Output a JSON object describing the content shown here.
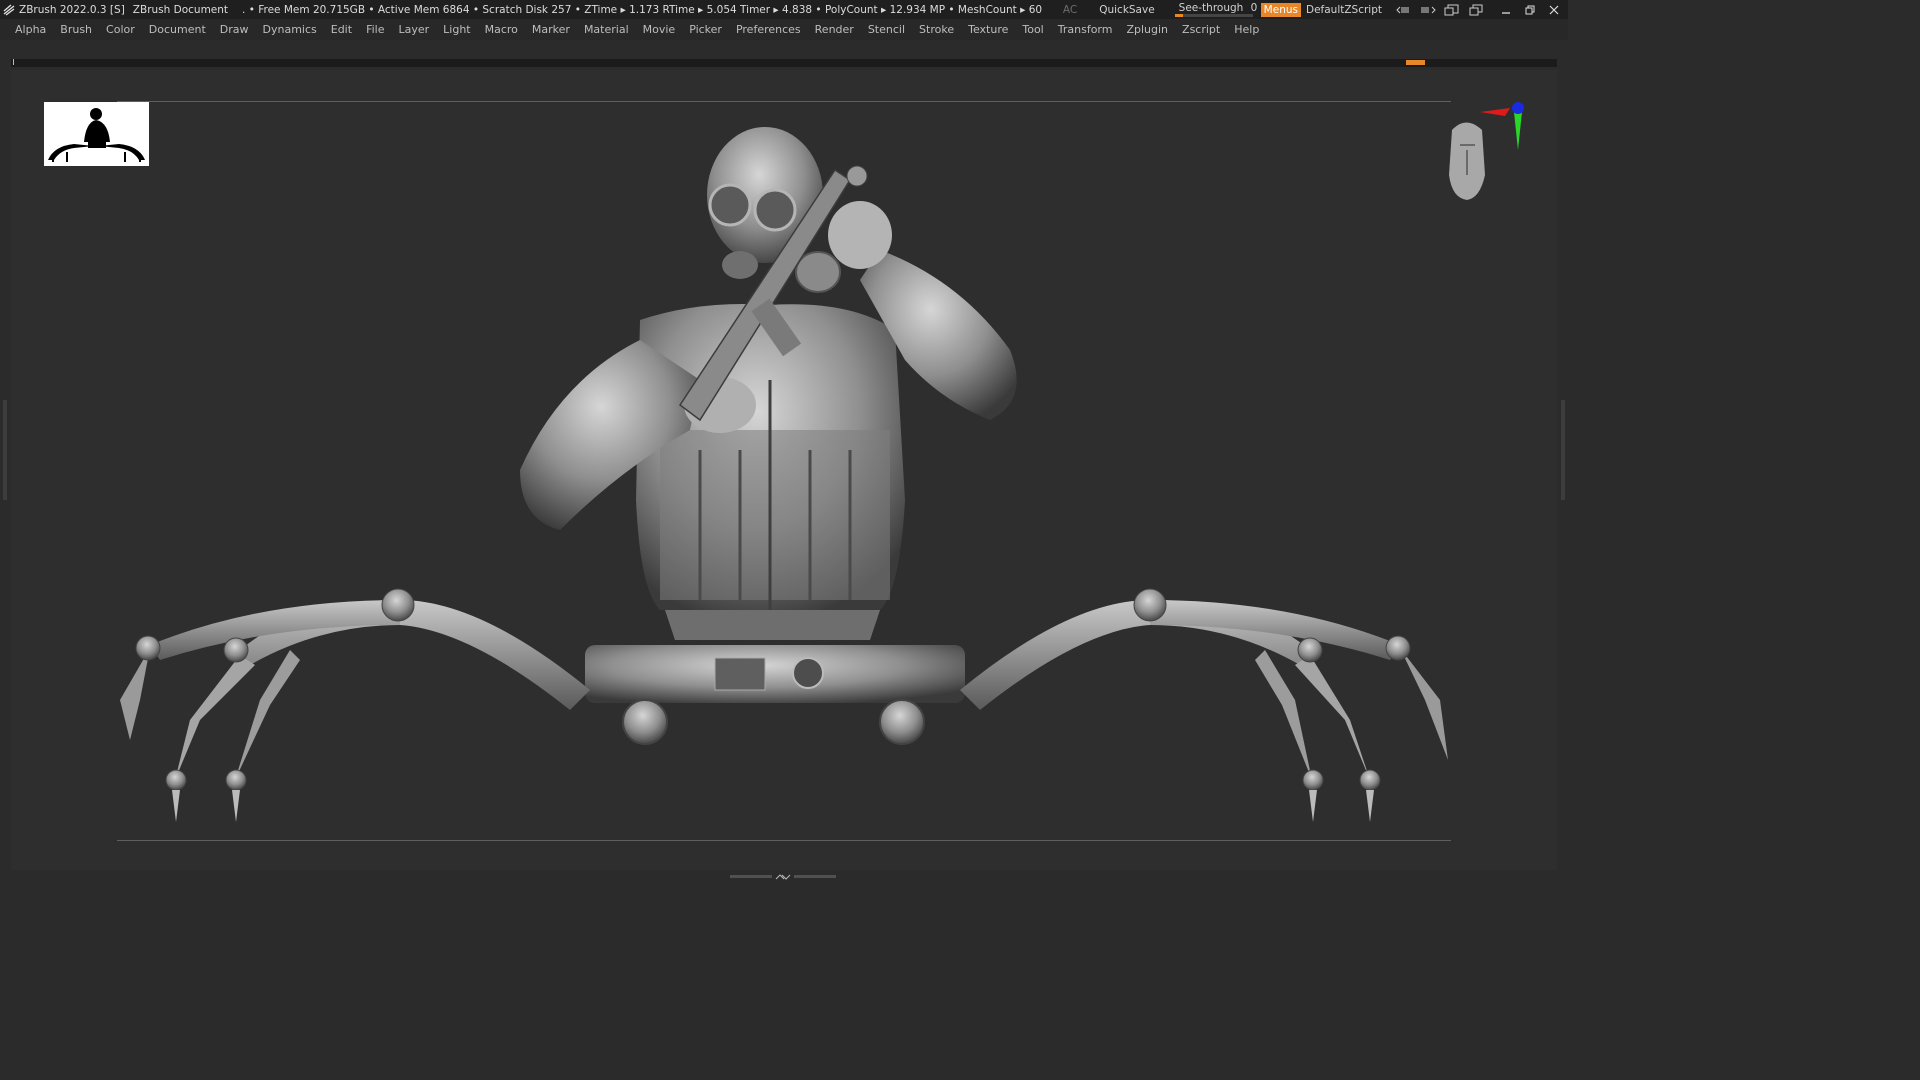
{
  "titlebar": {
    "app": "ZBrush 2022.0.3 [S]",
    "document": "ZBrush Document",
    "stats": ". • Free Mem 20.715GB • Active Mem 6864 • Scratch Disk 257 •  ZTime ▸ 1.173 RTime ▸ 5.054 Timer ▸ 4.838 • PolyCount ▸ 12.934 MP  • MeshCount ▸ 60",
    "ac": "AC",
    "quicksave": "QuickSave",
    "seethrough_label": "See-through",
    "seethrough_value": "0",
    "seethrough_fraction": 0.0,
    "menus": "Menus",
    "script": "DefaultZScript",
    "accent": "#e8862a"
  },
  "menubar": {
    "items": [
      "Alpha",
      "Brush",
      "Color",
      "Document",
      "Draw",
      "Dynamics",
      "Edit",
      "File",
      "Layer",
      "Light",
      "Macro",
      "Marker",
      "Material",
      "Movie",
      "Picker",
      "Preferences",
      "Render",
      "Stencil",
      "Stroke",
      "Texture",
      "Tool",
      "Transform",
      "Zplugin",
      "Zscript",
      "Help"
    ]
  },
  "icons": {
    "logo": "zbrush-logo-icon",
    "gizmo": "navigation-gizmo-icon",
    "head": "orientation-head-icon",
    "thumbnail": "alpha-thumbnail-silhouette"
  }
}
